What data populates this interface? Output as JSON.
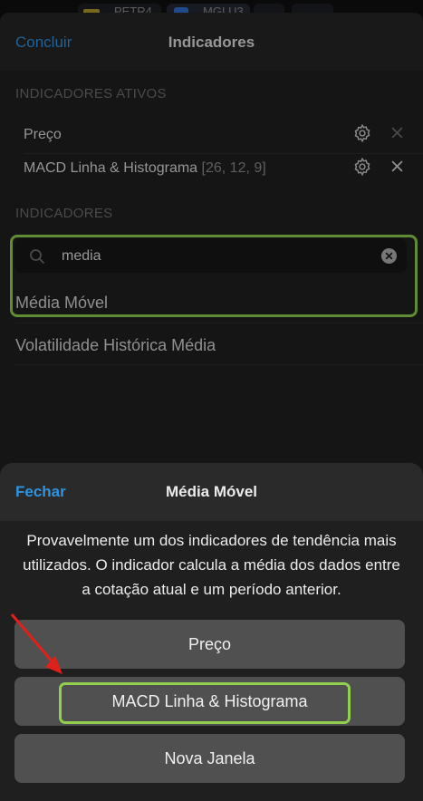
{
  "background_tabs": [
    "PETR4",
    "MGLU3"
  ],
  "header": {
    "done_label": "Concluir",
    "title": "Indicadores"
  },
  "active_section": {
    "title": "INDICADORES ATIVOS",
    "items": [
      {
        "name": "Preço",
        "params": ""
      },
      {
        "name": "MACD Linha & Histograma",
        "params": "[26, 12, 9]"
      }
    ]
  },
  "indicators_section": {
    "title": "INDICADORES",
    "search_value": "media",
    "results": [
      "Média Móvel",
      "Volatilidade Histórica Média"
    ]
  },
  "sheet": {
    "close_label": "Fechar",
    "title": "Média Móvel",
    "description": "Provavelmente um dos indicadores de tendência mais utilizados. O indicador calcula a média dos dados entre a cotação atual e um período anterior.",
    "options": [
      "Preço",
      "MACD Linha & Histograma",
      "Nova Janela"
    ]
  },
  "colors": {
    "accent": "#2f93e0",
    "highlight": "#8fd14f",
    "arrow": "#e0201b"
  }
}
